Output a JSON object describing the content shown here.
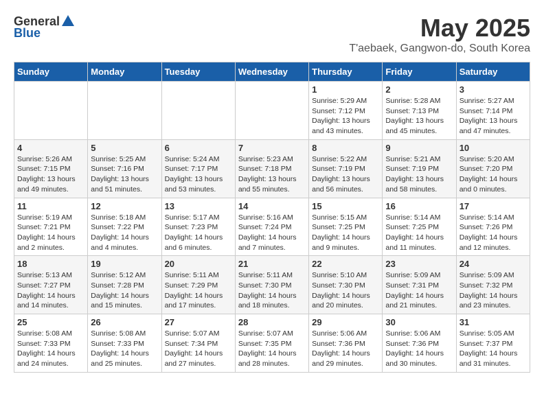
{
  "header": {
    "logo_general": "General",
    "logo_blue": "Blue",
    "title": "May 2025",
    "subtitle": "T'aebaek, Gangwon-do, South Korea"
  },
  "weekdays": [
    "Sunday",
    "Monday",
    "Tuesday",
    "Wednesday",
    "Thursday",
    "Friday",
    "Saturday"
  ],
  "weeks": [
    [
      {
        "day": "",
        "info": ""
      },
      {
        "day": "",
        "info": ""
      },
      {
        "day": "",
        "info": ""
      },
      {
        "day": "",
        "info": ""
      },
      {
        "day": "1",
        "info": "Sunrise: 5:29 AM\nSunset: 7:12 PM\nDaylight: 13 hours\nand 43 minutes."
      },
      {
        "day": "2",
        "info": "Sunrise: 5:28 AM\nSunset: 7:13 PM\nDaylight: 13 hours\nand 45 minutes."
      },
      {
        "day": "3",
        "info": "Sunrise: 5:27 AM\nSunset: 7:14 PM\nDaylight: 13 hours\nand 47 minutes."
      }
    ],
    [
      {
        "day": "4",
        "info": "Sunrise: 5:26 AM\nSunset: 7:15 PM\nDaylight: 13 hours\nand 49 minutes."
      },
      {
        "day": "5",
        "info": "Sunrise: 5:25 AM\nSunset: 7:16 PM\nDaylight: 13 hours\nand 51 minutes."
      },
      {
        "day": "6",
        "info": "Sunrise: 5:24 AM\nSunset: 7:17 PM\nDaylight: 13 hours\nand 53 minutes."
      },
      {
        "day": "7",
        "info": "Sunrise: 5:23 AM\nSunset: 7:18 PM\nDaylight: 13 hours\nand 55 minutes."
      },
      {
        "day": "8",
        "info": "Sunrise: 5:22 AM\nSunset: 7:19 PM\nDaylight: 13 hours\nand 56 minutes."
      },
      {
        "day": "9",
        "info": "Sunrise: 5:21 AM\nSunset: 7:19 PM\nDaylight: 13 hours\nand 58 minutes."
      },
      {
        "day": "10",
        "info": "Sunrise: 5:20 AM\nSunset: 7:20 PM\nDaylight: 14 hours\nand 0 minutes."
      }
    ],
    [
      {
        "day": "11",
        "info": "Sunrise: 5:19 AM\nSunset: 7:21 PM\nDaylight: 14 hours\nand 2 minutes."
      },
      {
        "day": "12",
        "info": "Sunrise: 5:18 AM\nSunset: 7:22 PM\nDaylight: 14 hours\nand 4 minutes."
      },
      {
        "day": "13",
        "info": "Sunrise: 5:17 AM\nSunset: 7:23 PM\nDaylight: 14 hours\nand 6 minutes."
      },
      {
        "day": "14",
        "info": "Sunrise: 5:16 AM\nSunset: 7:24 PM\nDaylight: 14 hours\nand 7 minutes."
      },
      {
        "day": "15",
        "info": "Sunrise: 5:15 AM\nSunset: 7:25 PM\nDaylight: 14 hours\nand 9 minutes."
      },
      {
        "day": "16",
        "info": "Sunrise: 5:14 AM\nSunset: 7:25 PM\nDaylight: 14 hours\nand 11 minutes."
      },
      {
        "day": "17",
        "info": "Sunrise: 5:14 AM\nSunset: 7:26 PM\nDaylight: 14 hours\nand 12 minutes."
      }
    ],
    [
      {
        "day": "18",
        "info": "Sunrise: 5:13 AM\nSunset: 7:27 PM\nDaylight: 14 hours\nand 14 minutes."
      },
      {
        "day": "19",
        "info": "Sunrise: 5:12 AM\nSunset: 7:28 PM\nDaylight: 14 hours\nand 15 minutes."
      },
      {
        "day": "20",
        "info": "Sunrise: 5:11 AM\nSunset: 7:29 PM\nDaylight: 14 hours\nand 17 minutes."
      },
      {
        "day": "21",
        "info": "Sunrise: 5:11 AM\nSunset: 7:30 PM\nDaylight: 14 hours\nand 18 minutes."
      },
      {
        "day": "22",
        "info": "Sunrise: 5:10 AM\nSunset: 7:30 PM\nDaylight: 14 hours\nand 20 minutes."
      },
      {
        "day": "23",
        "info": "Sunrise: 5:09 AM\nSunset: 7:31 PM\nDaylight: 14 hours\nand 21 minutes."
      },
      {
        "day": "24",
        "info": "Sunrise: 5:09 AM\nSunset: 7:32 PM\nDaylight: 14 hours\nand 23 minutes."
      }
    ],
    [
      {
        "day": "25",
        "info": "Sunrise: 5:08 AM\nSunset: 7:33 PM\nDaylight: 14 hours\nand 24 minutes."
      },
      {
        "day": "26",
        "info": "Sunrise: 5:08 AM\nSunset: 7:33 PM\nDaylight: 14 hours\nand 25 minutes."
      },
      {
        "day": "27",
        "info": "Sunrise: 5:07 AM\nSunset: 7:34 PM\nDaylight: 14 hours\nand 27 minutes."
      },
      {
        "day": "28",
        "info": "Sunrise: 5:07 AM\nSunset: 7:35 PM\nDaylight: 14 hours\nand 28 minutes."
      },
      {
        "day": "29",
        "info": "Sunrise: 5:06 AM\nSunset: 7:36 PM\nDaylight: 14 hours\nand 29 minutes."
      },
      {
        "day": "30",
        "info": "Sunrise: 5:06 AM\nSunset: 7:36 PM\nDaylight: 14 hours\nand 30 minutes."
      },
      {
        "day": "31",
        "info": "Sunrise: 5:05 AM\nSunset: 7:37 PM\nDaylight: 14 hours\nand 31 minutes."
      }
    ]
  ]
}
